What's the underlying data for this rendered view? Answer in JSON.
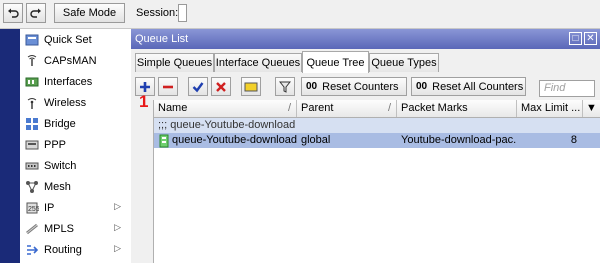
{
  "topbar": {
    "undo_icon": "undo-icon",
    "redo_icon": "redo-icon",
    "safe_mode_label": "Safe Mode",
    "session_label": "Session:"
  },
  "sidebar": {
    "items": [
      {
        "label": "Quick Set",
        "icon": "quick-set-icon",
        "submenu": false
      },
      {
        "label": "CAPsMAN",
        "icon": "capsman-icon",
        "submenu": false
      },
      {
        "label": "Interfaces",
        "icon": "interfaces-icon",
        "submenu": false
      },
      {
        "label": "Wireless",
        "icon": "wireless-icon",
        "submenu": false
      },
      {
        "label": "Bridge",
        "icon": "bridge-icon",
        "submenu": false
      },
      {
        "label": "PPP",
        "icon": "ppp-icon",
        "submenu": false
      },
      {
        "label": "Switch",
        "icon": "switch-icon",
        "submenu": false
      },
      {
        "label": "Mesh",
        "icon": "mesh-icon",
        "submenu": false
      },
      {
        "label": "IP",
        "icon": "ip-icon",
        "submenu": true
      },
      {
        "label": "MPLS",
        "icon": "mpls-icon",
        "submenu": true
      },
      {
        "label": "Routing",
        "icon": "routing-icon",
        "submenu": true
      }
    ]
  },
  "window": {
    "title": "Queue List",
    "restore_glyph": "□",
    "close_glyph": "✕",
    "tabs": [
      {
        "label": "Simple Queues",
        "active": false
      },
      {
        "label": "Interface Queues",
        "active": false
      },
      {
        "label": "Queue Tree",
        "active": true
      },
      {
        "label": "Queue Types",
        "active": false
      }
    ],
    "toolbar": {
      "reset_counters_label": "Reset Counters",
      "reset_all_counters_label": "Reset All Counters",
      "oo_label": "00",
      "find_placeholder": "Find"
    },
    "annotation": "1",
    "table": {
      "columns": [
        "Name",
        "Parent",
        "Packet Marks",
        "Max Limit ..."
      ],
      "rows": [
        {
          "comment": ";;; queue-Youtube-download"
        },
        {
          "name": "queue-Youtube-download",
          "parent": "global",
          "packet_marks": "Youtube-download-pac...",
          "max_limit": "8"
        }
      ]
    }
  },
  "colors": {
    "titlebar": "#6b78c6",
    "left_strip": "#1a2a78",
    "row_selected": "#a9bce3",
    "row_comment": "#d6e0f2",
    "annotation": "#e81818"
  }
}
